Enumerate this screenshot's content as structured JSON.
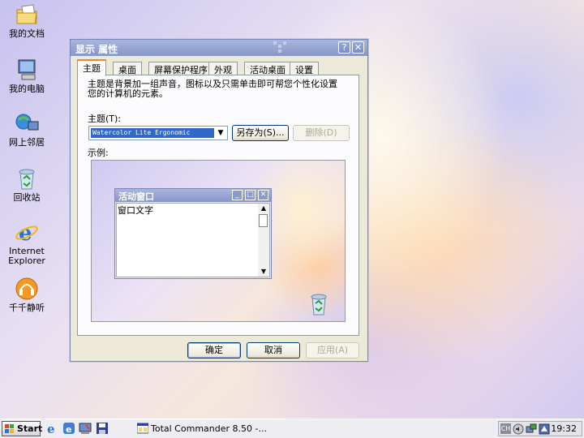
{
  "desktop": {
    "icons": [
      {
        "label": "我的文档"
      },
      {
        "label": "我的电脑"
      },
      {
        "label": "网上邻居"
      },
      {
        "label": "回收站"
      },
      {
        "label": "Internet Explorer"
      },
      {
        "label": "千千静听"
      }
    ]
  },
  "dialog": {
    "title": "显示 属性",
    "help_label": "?",
    "close_label": "✕",
    "tabs": [
      {
        "label": "主题",
        "active": true
      },
      {
        "label": "桌面"
      },
      {
        "label": "屏幕保护程序"
      },
      {
        "label": "外观"
      },
      {
        "label": "活动桌面"
      },
      {
        "label": "设置"
      }
    ],
    "description": "主题是背景加一组声音，图标以及只需单击即可帮您个性化设置您的计算机的元素。",
    "theme_label": "主题(T):",
    "theme_value": "Watercolor Lite Ergonomic",
    "save_as_label": "另存为(S)...",
    "delete_label": "删除(D)",
    "preview_label": "示例:",
    "preview": {
      "window_title": "活动窗口",
      "window_text": "窗口文字"
    },
    "buttons": {
      "ok": "确定",
      "cancel": "取消",
      "apply": "应用(A)"
    }
  },
  "taskbar": {
    "start_label": "Start",
    "task_label": "Total Commander 8.50 -...",
    "tray_lang": "CH",
    "clock": "19:32"
  }
}
